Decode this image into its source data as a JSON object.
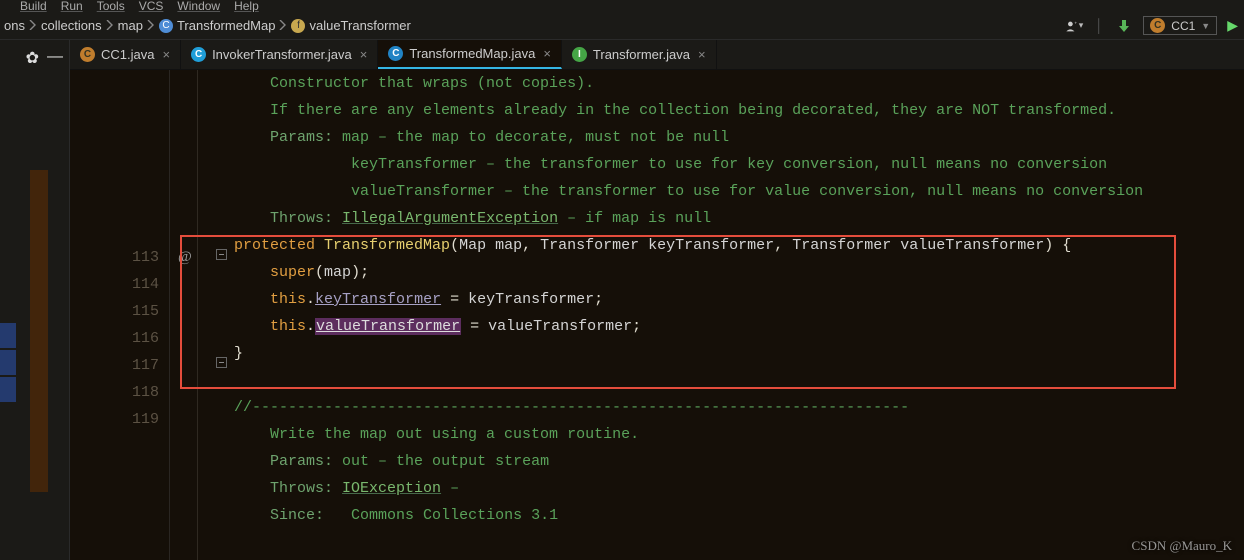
{
  "menu": {
    "build": "Build",
    "run": "Run",
    "tools": "Tools",
    "vcs": "VCS",
    "window": "Window",
    "help": "Help"
  },
  "breadcrumb": {
    "a": "",
    "b": "ons",
    "c": "collections",
    "d": "map",
    "e": "TransformedMap",
    "f": "valueTransformer"
  },
  "runcfg": {
    "name": "CC1"
  },
  "tabs": [
    {
      "label": "CC1.java"
    },
    {
      "label": "InvokerTransformer.java"
    },
    {
      "label": "TransformedMap.java"
    },
    {
      "label": "Transformer.java"
    }
  ],
  "gutter": {
    "l1": "113",
    "l2": "114",
    "l3": "115",
    "l4": "116",
    "l5": "117",
    "l6": "118",
    "l7": "119",
    "annot": "@"
  },
  "doc": {
    "d1": "Constructor that wraps (not copies).",
    "d2": "If there are any elements already in the collection being decorated, they are NOT transformed.",
    "p0": "Params:",
    "p1": "map – the map to decorate, must not be null",
    "p2": "keyTransformer – the transformer to use for key conversion, null means no conversion",
    "p3": "valueTransformer – the transformer to use for value conversion, null means no conversion",
    "t0": "Throws:",
    "t1": "IllegalArgumentException",
    "t2": " – if map is null",
    "w1": "Write the map out using a custom routine.",
    "w2p": "Params:",
    "w2": "out – the output stream",
    "w3p": "Throws:",
    "w3": "IOException",
    "w3b": " –",
    "w4p": "Since:",
    "w4": "Commons Collections 3.1"
  },
  "code": {
    "kw_protected": "protected",
    "cls": "TransformedMap",
    "lp": "(",
    "ty_map": "Map ",
    "var_map": "map",
    "comma": ", ",
    "ty_tx": "Transformer ",
    "var_kt": "keyTransformer",
    "var_vt": "valueTransformer",
    "rp": ") {",
    "super": "super",
    "obr": "(",
    "cbrsemi": ");",
    "this": "this",
    "dot": ".",
    "kf": "keyTransformer",
    "eq": " = ",
    "semi": ";",
    "vf": "valueTransformer",
    "close": "}",
    "dashes": "//-------------------------------------------------------------------------"
  },
  "watermark": "CSDN @Mauro_K"
}
